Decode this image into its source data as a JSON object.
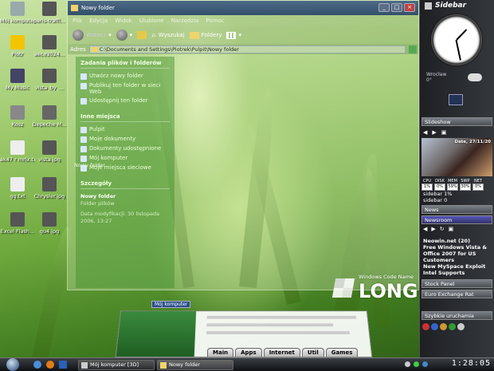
{
  "desktop_icons": [
    {
      "label": "Mój komputer",
      "icon": "computer-icon",
      "color": "#9aa"
    },
    {
      "label": "paris-traffi...",
      "icon": "image-file-icon",
      "color": "#555"
    },
    {
      "label": "Piotr",
      "icon": "star-folder-icon",
      "color": "#f4c400"
    },
    {
      "label": "aece3024...",
      "icon": "image-file-icon",
      "color": "#555"
    },
    {
      "label": "My Music",
      "icon": "music-folder-icon",
      "color": "#446"
    },
    {
      "label": "vista_by_...",
      "icon": "image-file-icon",
      "color": "#555"
    },
    {
      "label": "Kosz",
      "icon": "recycle-bin-icon",
      "color": "#888"
    },
    {
      "label": "Depeche M...",
      "icon": "media-file-icon",
      "color": "#666"
    },
    {
      "label": "ak47 r mrlx.txt",
      "icon": "text-file-icon",
      "color": "#eee"
    },
    {
      "label": "vista.jpg",
      "icon": "image-file-icon",
      "color": "#555"
    },
    {
      "label": "gg.txt",
      "icon": "text-file-icon",
      "color": "#eee"
    },
    {
      "label": "Chrysler.jpg",
      "icon": "image-file-icon",
      "color": "#555"
    },
    {
      "label": "Excel Flash...",
      "icon": "flash-file-icon",
      "color": "#555"
    },
    {
      "label": "gu4.jpg",
      "icon": "image-file-icon",
      "color": "#555"
    }
  ],
  "window": {
    "title": "Nowy folder",
    "menu": [
      "Plik",
      "Edycja",
      "Widok",
      "Ulubione",
      "Narzędzia",
      "Pomoc"
    ],
    "toolbar": {
      "back": "Wstecz",
      "search": "Wyszukaj",
      "folders": "Foldery"
    },
    "address_label": "Adres",
    "address_value": "C:\\Documents and Settings\\Piotrek\\Pulpit\\Nowy folder"
  },
  "task_pane": {
    "file_tasks_title": "Zadania plików i folderów",
    "file_tasks": [
      "Utwórz nowy folder",
      "Publikuj ten folder w sieci Web",
      "Udostępnij ten folder"
    ],
    "places_title": "Inne miejsca",
    "places": [
      "Pulpit",
      "Moje dokumenty",
      "Dokumenty udostępnione",
      "Mój komputer",
      "Moje miejsca sieciowe"
    ],
    "details_title": "Szczegóły",
    "details_name": "Nowy folder",
    "details_type": "Folder plików",
    "details_date": "Data modyfikacji: 30 listopada 2006, 13:27"
  },
  "overlay_label": "Nowy folder",
  "logo": {
    "caption": "Windows Code Name",
    "text": "LONGHO"
  },
  "sidebar": {
    "title": "Sidebar",
    "clock": {
      "hour": 1,
      "minute": 28
    },
    "weather": {
      "label": "Wrocław",
      "temp": "0°"
    },
    "slideshow_title": "Slideshow",
    "slideshow_caption": "Date, 27/11/20",
    "cpu_labels": [
      "CPU",
      "DISK",
      "MEM",
      "SWP",
      "NET"
    ],
    "cpu_values": [
      "1%",
      "0%",
      "59%",
      "30%",
      "0%"
    ],
    "cpu_lines": [
      "sidebar 1%",
      "sidebar 0"
    ],
    "news_title": "News",
    "newsroom_title": "Newsroom",
    "news_items": [
      "Neowin.net (20)",
      "Free Windows Vista & Office 2007 for US Customers",
      "New MySpace Exploit",
      "Intel Supports"
    ],
    "stock_panel": "Stock Panel",
    "euro_exchange": "Euro Exchange Rat",
    "quick_launch": "Szybkie uruchamia"
  },
  "preview": {
    "label": "Mój komputer",
    "tabs": [
      "Main",
      "Apps",
      "Internet",
      "Util",
      "Games"
    ]
  },
  "taskbar": {
    "tasks": [
      "Mój komputer [3D]",
      "Nowy folder"
    ],
    "time": "1:28:05"
  }
}
